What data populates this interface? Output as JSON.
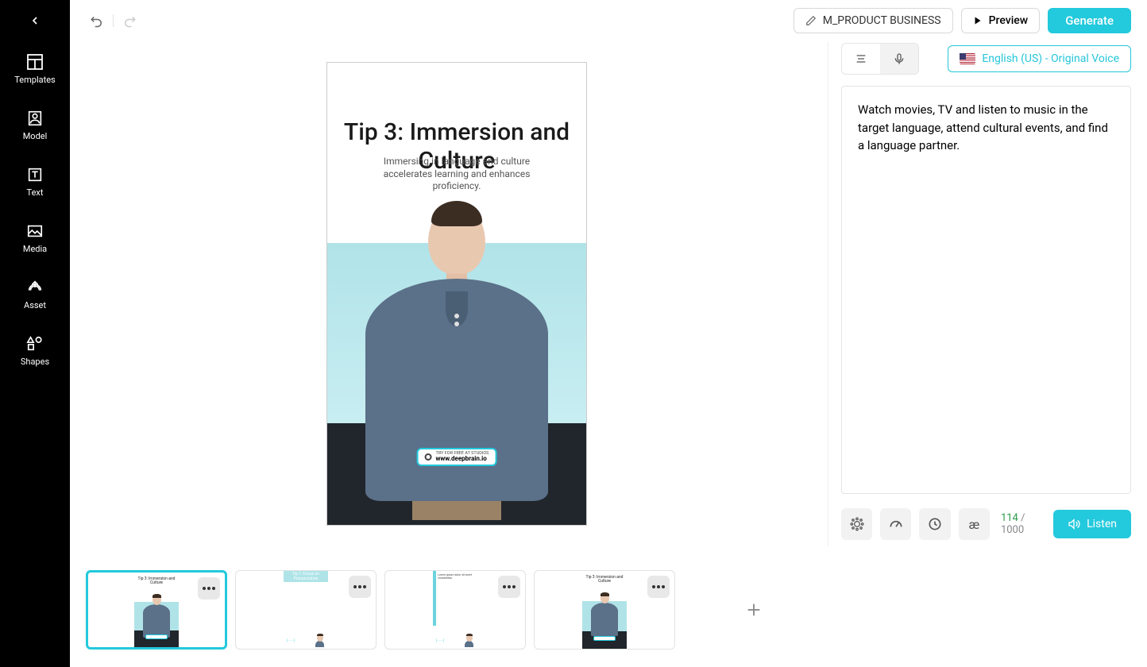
{
  "sidebar": {
    "items": [
      {
        "label": "Templates"
      },
      {
        "label": "Model"
      },
      {
        "label": "Text"
      },
      {
        "label": "Media"
      },
      {
        "label": "Asset"
      },
      {
        "label": "Shapes"
      }
    ]
  },
  "topbar": {
    "project_name": "M_PRODUCT BUSINESS",
    "preview_label": "Preview",
    "generate_label": "Generate"
  },
  "slide": {
    "title": "Tip 3: Immersion and Culture",
    "subtitle": "Immersing in language and culture accelerates learning and enhances proficiency.",
    "watermark_label": "TRY FOR FREE AT STUDIOS",
    "watermark_url": "www.deepbrain.io"
  },
  "right_panel": {
    "language_label": "English (US) - Original Voice",
    "script_text": "Watch movies, TV and listen to music in the target language, attend cultural events, and find a language partner.",
    "char_count": "114",
    "char_max": "/ 1000",
    "listen_label": "Listen",
    "phonetic_symbol": "æ"
  },
  "thumbs": {
    "t1_title": "Tip 3: Immersion and Culture",
    "t2_title": "Tip 1: Focus on Pronunciation",
    "t3_title": "Lorem ipsum dolor sit amet consectetur",
    "t4_title": "Tip 3: Immersion and Culture"
  }
}
